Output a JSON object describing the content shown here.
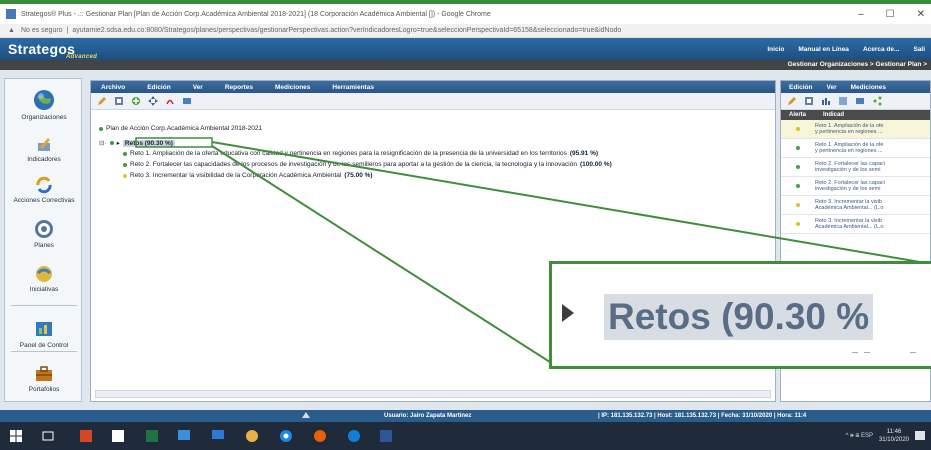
{
  "browser": {
    "title": "Strategos® Plus - .:: Gestionar Plan [Plan de Acción Corp.Académica Ambiental 2018-2021] (18 Corporación Académica Ambiental []) - Google Chrome",
    "address_warning": "No es seguro",
    "url": "ayutamie2.sdsa.edu.co:8080/Strategos/planes/perspectivas/gestionarPerspectivas.action?verIndicadoresLogro=true&seleccionPerspectivaId=65158&seleccionado=true&idNodo"
  },
  "app": {
    "logo": "Strategos",
    "logo_sub": "Advanced",
    "topnav": [
      "Inicio",
      "Manual en Línea",
      "Acerca de...",
      "Sali"
    ],
    "breadcrumb": "Gestionar Organizaciones > Gestionar Plan >"
  },
  "sidebar": {
    "items": [
      {
        "label": "Organizaciones",
        "icon": "globe-icon"
      },
      {
        "label": "Indicadores",
        "icon": "indicator-pencil-icon"
      },
      {
        "label": "Acciones Correctivas",
        "icon": "refresh-icon"
      },
      {
        "label": "Planes",
        "icon": "target-icon"
      },
      {
        "label": "Iniciativas",
        "icon": "initiative-icon"
      },
      {
        "label": "Panel de Control",
        "icon": "control-panel-icon"
      },
      {
        "label": "Portafolios",
        "icon": "briefcase-icon"
      }
    ]
  },
  "center": {
    "menus": [
      "Archivo",
      "Edición",
      "Ver",
      "Reportes",
      "Mediciones",
      "Herramientas"
    ],
    "tree": {
      "root": "Plan de Acción Corp.Académica Ambiental 2018-2021",
      "selected_label": "Retos",
      "selected_pct": "(90.30 %)",
      "children": [
        {
          "label": "Reto 1. Ampliación de la oferta educativa con calidad y pertinencia en regiones para la resignificación de la presencia de la universidad en los territorios",
          "pct": "(95.91 %)"
        },
        {
          "label": "Reto 2. Fortalecer las capacidades de los procesos de investigación y de los semilleros para aportar a la gestión de la ciencia, la tecnología y la innovación",
          "pct": "(100.00 %)"
        },
        {
          "label": "Reto 3. Incrementar la visibilidad de la Corporación Académica Ambiental",
          "pct": "(75.00 %)"
        }
      ]
    }
  },
  "right": {
    "menus": [
      "Edición",
      "Ver",
      "Mediciones"
    ],
    "headers": [
      "Alerta",
      "Indicad"
    ],
    "rows": [
      {
        "line1": "Reto 1. Ampliación de la ofe",
        "line2": "y pertinencia en regiones ...",
        "alert_color": "#d9c321"
      },
      {
        "line1": "Reto 1. Ampliación de la ofe",
        "line2": "y pertinencia en regiones ...",
        "alert_color": "#43a347"
      },
      {
        "line1": "Reto 2. Fortalecer las capaci",
        "line2": "investigación y de los semi",
        "alert_color": "#43a347"
      },
      {
        "line1": "Reto 2. Fortalecer las capaci",
        "line2": "investigación y de los semi",
        "alert_color": "#43a347"
      },
      {
        "line1": "Reto 3. Incrementar la visib",
        "line2": "Académica Ambiental... (L.o",
        "alert_color": "#d9c321"
      },
      {
        "line1": "Reto 3. Incrementar la visib",
        "line2": "Académica Ambiental... (L.o",
        "alert_color": "#d9c321"
      }
    ]
  },
  "zoom": {
    "text": "Retos (90.30 %"
  },
  "status": {
    "user": "Usuario: Jairo Zapata Martínez",
    "info": "| IP: 181.135.132.73 | Host: 181.135.132.73 | Fecha: 31/10/2020 | Hora: 11:4"
  },
  "taskbar": {
    "time": "11:46",
    "date": "31/10/2020",
    "tray": "^ 🕪 ⊞ ESP"
  }
}
